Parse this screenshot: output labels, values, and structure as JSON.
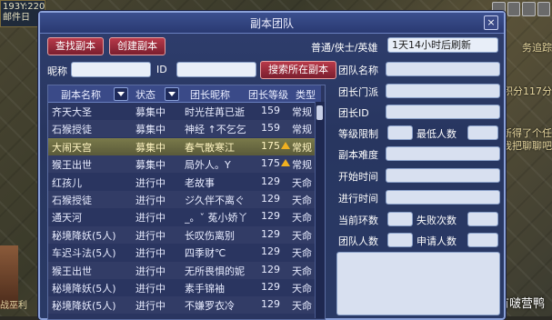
{
  "scene": {
    "coords": "193Y:220",
    "coords_sub": "邮件日",
    "left_bottom_text": "战巫利",
    "right_texts": [
      "务追踪",
      "务积分117分",
      "新得了个任",
      "我把聊聊吧"
    ]
  },
  "watermark": "有啵营鸭",
  "window": {
    "title": "副本团队",
    "close": "×"
  },
  "toolbar": {
    "find_label": "查找副本",
    "create_label": "创建副本",
    "mode_label": "普通/侠士/英雄",
    "refresh_value": "1天14小时后刷新",
    "nickname_label": "昵称",
    "id_label": "ID",
    "search_label": "搜索所在副本"
  },
  "list": {
    "headers": {
      "name": "副本名称",
      "status": "状态",
      "leader": "团长昵称",
      "level": "团长等级",
      "type": "类型"
    },
    "rows": [
      {
        "name": "齐天大圣",
        "status": "募集中",
        "leader": "时光荏苒已逝",
        "level": "159",
        "type": "常规"
      },
      {
        "name": "石猴授徒",
        "status": "募集中",
        "leader": "神经 ↑不乞乞",
        "level": "159",
        "type": "常规"
      },
      {
        "name": "大闹天宫",
        "status": "募集中",
        "leader": "春气散寒江",
        "level": "175",
        "type": "常规"
      },
      {
        "name": "猴王出世",
        "status": "募集中",
        "leader": "局外人。Y",
        "level": "175",
        "type": "常规"
      },
      {
        "name": "红孩儿",
        "status": "进行中",
        "leader": "老故事",
        "level": "129",
        "type": "天命"
      },
      {
        "name": "石猴授徒",
        "status": "进行中",
        "leader": "ジ久伴不离ぐ",
        "level": "129",
        "type": "天命"
      },
      {
        "name": "通天河",
        "status": "进行中",
        "leader": "_。ˇ 菟小娇丫",
        "level": "129",
        "type": "天命"
      },
      {
        "name": "秘境降妖(5人)",
        "status": "进行中",
        "leader": "长叹伤离别",
        "level": "129",
        "type": "天命"
      },
      {
        "name": "车迟斗法(5人)",
        "status": "进行中",
        "leader": "四季财℃",
        "level": "129",
        "type": "天命"
      },
      {
        "name": "猴王出世",
        "status": "进行中",
        "leader": "无所畏惧的妮",
        "level": "129",
        "type": "天命"
      },
      {
        "name": "秘境降妖(5人)",
        "status": "进行中",
        "leader": "素手锦袖",
        "level": "129",
        "type": "天命"
      },
      {
        "name": "秘境降妖(5人)",
        "status": "进行中",
        "leader": "不嫌罗衣冷",
        "level": "129",
        "type": "天命"
      }
    ]
  },
  "panel": {
    "team_name": "团队名称",
    "leader_sect": "团长门派",
    "leader_id": "团长ID",
    "level_limit": "等级限制",
    "min_people": "最低人数",
    "difficulty": "副本难度",
    "start_time": "开始时间",
    "progress_time": "进行时间",
    "current_round": "当前环数",
    "fail_count": "失败次数",
    "team_count": "团队人数",
    "applicants": "申请人数"
  }
}
